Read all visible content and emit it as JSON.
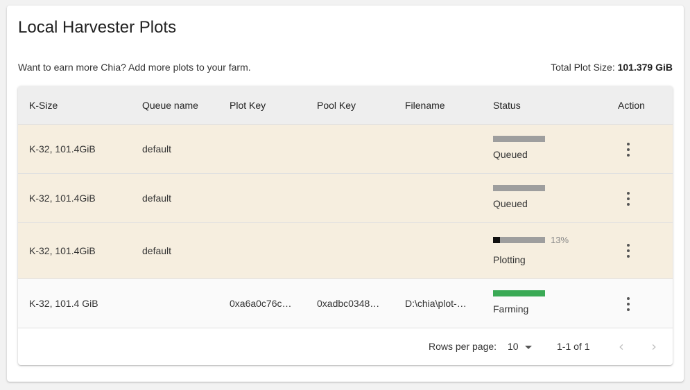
{
  "page": {
    "title": "Local Harvester Plots",
    "subtitle": "Want to earn more Chia? Add more plots to your farm.",
    "total_label": "Total Plot Size: ",
    "total_value": "101.379 GiB"
  },
  "table": {
    "headers": [
      "K-Size",
      "Queue name",
      "Plot Key",
      "Pool Key",
      "Filename",
      "Status",
      "Action"
    ],
    "rows": [
      {
        "ksize": "K-32, 101.4GiB",
        "queue": "default",
        "plot_key": "",
        "pool_key": "",
        "filename": "",
        "status": "Queued",
        "progress": 1.0,
        "bar_color": "#9e9e9e"
      },
      {
        "ksize": "K-32, 101.4GiB",
        "queue": "default",
        "plot_key": "",
        "pool_key": "",
        "filename": "",
        "status": "Queued",
        "progress": 1.0,
        "bar_color": "#9e9e9e"
      },
      {
        "ksize": "K-32, 101.4GiB",
        "queue": "default",
        "plot_key": "",
        "pool_key": "",
        "filename": "",
        "status": "Plotting",
        "progress": 0.13,
        "progress_text": "13%",
        "bar_color": "#9e9e9e"
      },
      {
        "ksize": "K-32, 101.4 GiB",
        "queue": "",
        "plot_key": "0xa6a0c76c…",
        "pool_key": "0xadbc0348…",
        "filename": "D:\\chia\\plot-…",
        "status": "Farming",
        "progress": 1.0,
        "bar_color": "#3aaa55"
      }
    ]
  },
  "pagination": {
    "rows_per_page_label": "Rows per page:",
    "rows_per_page_value": "10",
    "range_text": "1-1 of 1"
  },
  "icons": {
    "action": "more-vert-icon",
    "prev": "chevron-left-icon",
    "next": "chevron-right-icon",
    "dropdown": "caret-down-icon"
  },
  "colors": {
    "queued_row_bg": "#f6eedf",
    "farming_bar": "#3aaa55",
    "progress_fill": "#111111",
    "progress_track": "#9e9e9e"
  }
}
